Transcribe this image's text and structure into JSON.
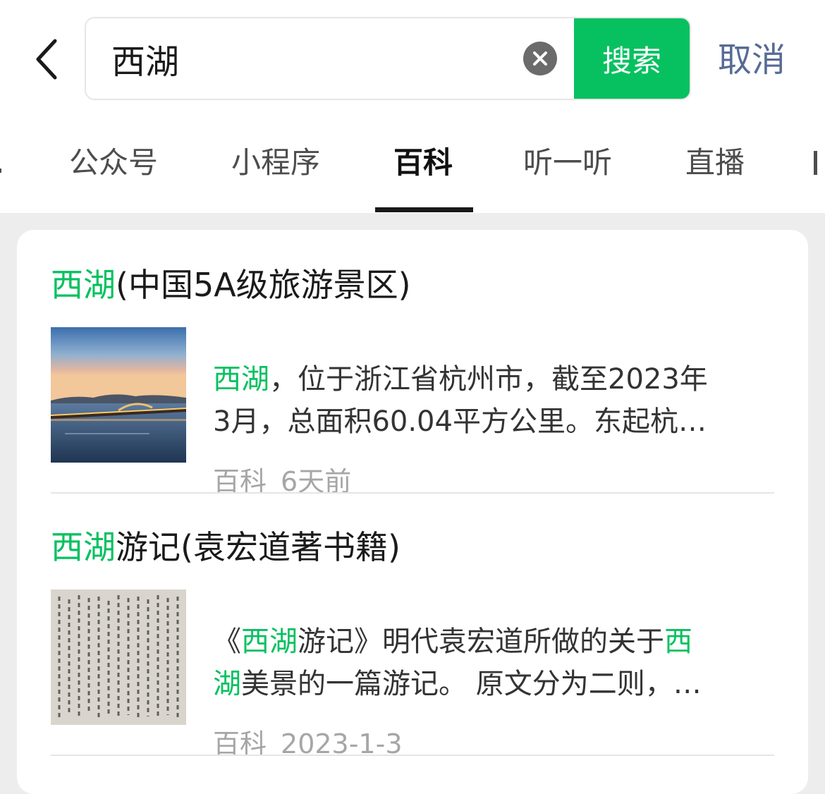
{
  "header": {
    "search": {
      "value": "西湖",
      "button_label": "搜索"
    },
    "cancel_label": "取消"
  },
  "tabs": [
    {
      "label": "公众号",
      "active": false
    },
    {
      "label": "小程序",
      "active": false
    },
    {
      "label": "百科",
      "active": true
    },
    {
      "label": "听一听",
      "active": false
    },
    {
      "label": "直播",
      "active": false
    }
  ],
  "results": [
    {
      "title_highlight": "西湖",
      "title_rest": "(中国5A级旅游景区)",
      "snippet_highlight": "西湖",
      "snippet_line1": "，位于浙江省杭州市，截至2023年",
      "snippet_line2": "3月，总面积60.04平方公里。东起杭…",
      "source": "百科",
      "time": "6天前",
      "thumb_icon": "west-lake-evening-photo"
    },
    {
      "title_highlight": "西湖",
      "title_rest": "游记(袁宏道著书籍)",
      "snippet_pre": "《",
      "snippet_highlight1": "西湖",
      "snippet_mid": "游记》明代袁宏道所做的关于",
      "snippet_highlight2": "西",
      "snippet_highlight3": "湖",
      "snippet_line2_rest": "美景的一篇游记。 原文分为二则，…",
      "source": "百科",
      "time": "2023-1-3",
      "thumb_icon": "calligraphy-manuscript-photo"
    }
  ],
  "colors": {
    "accent": "#07c160",
    "link": "#576b95",
    "meta": "#a6a6a6",
    "background": "#ededed"
  }
}
